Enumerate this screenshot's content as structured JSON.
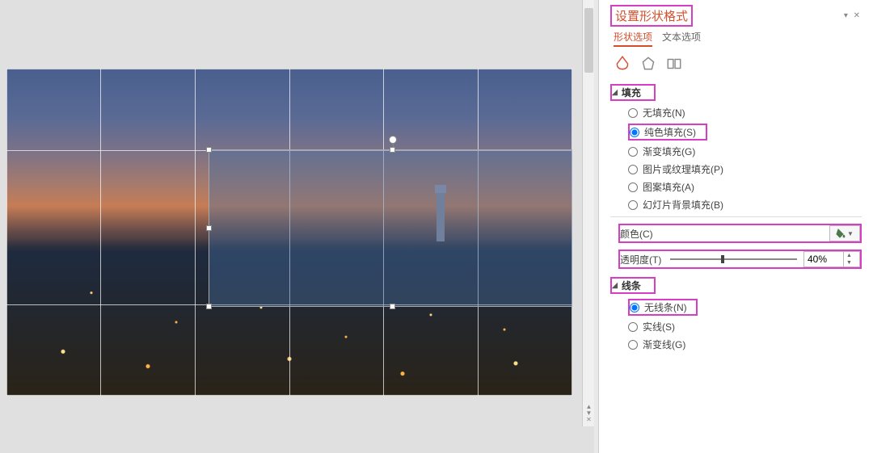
{
  "panel": {
    "title": "设置形状格式",
    "controls": "▾ ✕",
    "tabs": {
      "shape": "形状选项",
      "text": "文本选项"
    }
  },
  "fill": {
    "header": "填充",
    "options": {
      "none": "无填充(N)",
      "solid": "纯色填充(S)",
      "gradient": "渐变填充(G)",
      "picture": "图片或纹理填充(P)",
      "pattern": "图案填充(A)",
      "slidebg": "幻灯片背景填充(B)"
    },
    "selected": "solid",
    "color_label": "颜色(C)",
    "transparency_label": "透明度(T)",
    "transparency_value": "40%",
    "transparency_pct": 40
  },
  "line": {
    "header": "线条",
    "options": {
      "none": "无线条(N)",
      "solid": "实线(S)",
      "gradient": "渐变线(G)"
    },
    "selected": "none"
  }
}
